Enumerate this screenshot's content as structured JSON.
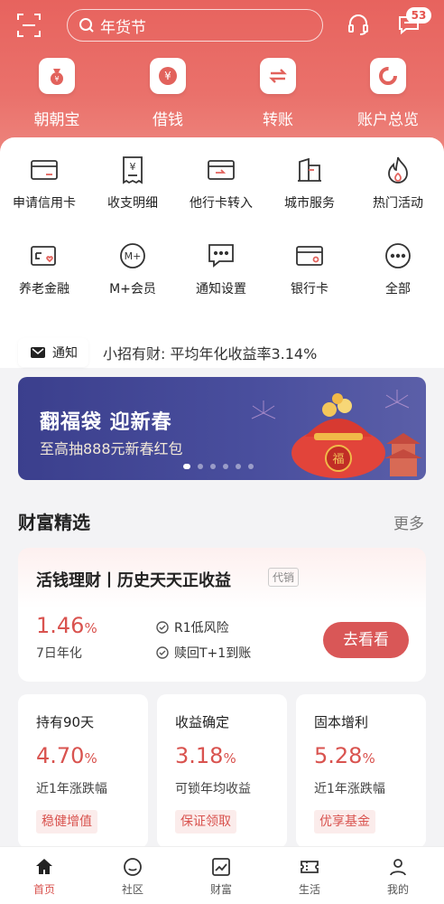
{
  "header": {
    "search_placeholder": "年货节",
    "message_badge": "53"
  },
  "quick_actions": [
    {
      "label": "朝朝宝",
      "icon": "money-bag-icon"
    },
    {
      "label": "借钱",
      "icon": "yuan-coin-icon"
    },
    {
      "label": "转账",
      "icon": "transfer-arrows-icon"
    },
    {
      "label": "账户总览",
      "icon": "donut-chart-icon"
    }
  ],
  "services": [
    {
      "label": "申请信用卡",
      "icon": "credit-card-icon"
    },
    {
      "label": "收支明细",
      "icon": "receipt-icon"
    },
    {
      "label": "他行卡转入",
      "icon": "card-transfer-in-icon"
    },
    {
      "label": "城市服务",
      "icon": "city-building-icon"
    },
    {
      "label": "热门活动",
      "icon": "flame-icon"
    },
    {
      "label": "养老金融",
      "icon": "pension-card-icon"
    },
    {
      "label": "M+会员",
      "icon": "m-plus-member-icon"
    },
    {
      "label": "通知设置",
      "icon": "chat-bubble-icon"
    },
    {
      "label": "银行卡",
      "icon": "bank-card-icon"
    },
    {
      "label": "全部",
      "icon": "more-dots-icon"
    }
  ],
  "notice": {
    "tag": "通知",
    "text": "小招有财: 平均年化收益率3.14%"
  },
  "banner": {
    "title": "翻福袋  迎新春",
    "subtitle": "至高抽888元新春红包",
    "slides": 6,
    "active_slide": 1
  },
  "wealth": {
    "title": "财富精选",
    "more": "更多",
    "featured": {
      "title": "活钱理财丨历史天天正收益",
      "tag": "代销",
      "rate": "1.46",
      "rate_unit": "%",
      "rate_label": "7日年化",
      "features": [
        "R1低风险",
        "赎回T+1到账"
      ],
      "button": "去看看"
    },
    "products": [
      {
        "title": "持有90天",
        "rate": "4.70",
        "unit": "%",
        "label": "近1年涨跌幅",
        "tag": "稳健增值"
      },
      {
        "title": "收益确定",
        "rate": "3.18",
        "unit": "%",
        "label": "可锁年均收益",
        "tag": "保证领取"
      },
      {
        "title": "固本增利",
        "rate": "5.28",
        "unit": "%",
        "label": "近1年涨跌幅",
        "tag": "优享基金"
      }
    ]
  },
  "tabbar": [
    {
      "label": "首页",
      "icon": "home-icon"
    },
    {
      "label": "社区",
      "icon": "community-icon"
    },
    {
      "label": "财富",
      "icon": "wealth-chart-icon"
    },
    {
      "label": "生活",
      "icon": "ticket-icon"
    },
    {
      "label": "我的",
      "icon": "profile-icon"
    }
  ],
  "colors": {
    "brand_red": "#e7635e",
    "accent": "#d9534f"
  }
}
